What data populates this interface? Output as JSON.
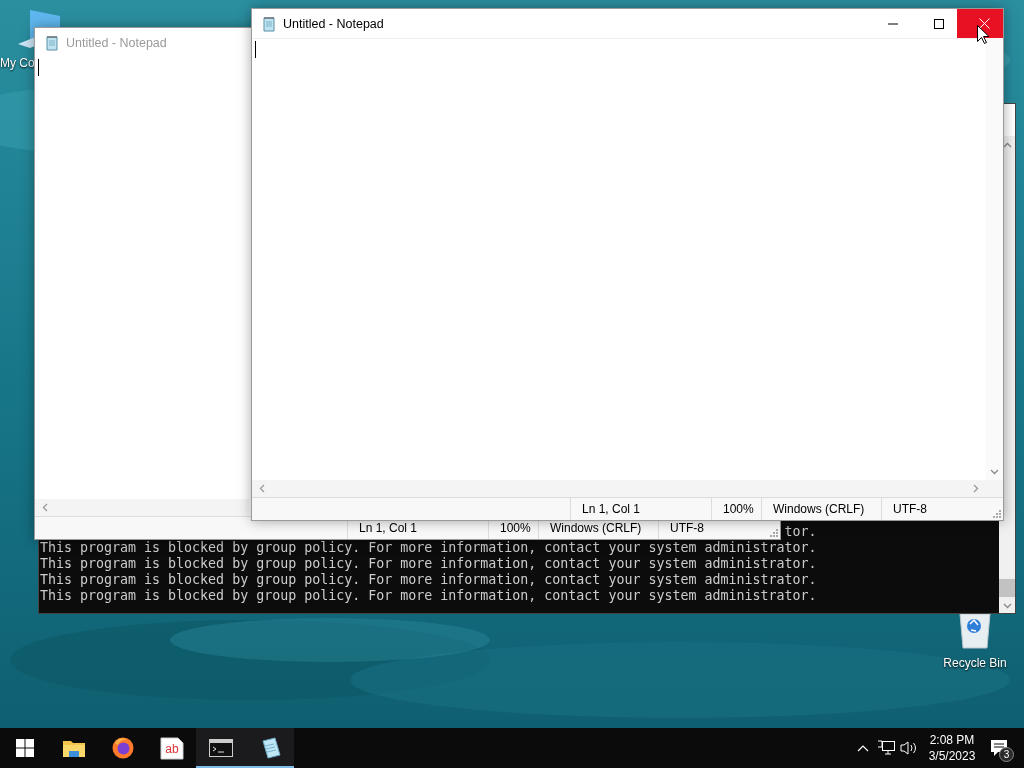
{
  "desktop": {
    "icons": [
      {
        "kind": "computer",
        "label": "My Co"
      },
      {
        "kind": "recycle_bin",
        "label": "Recycle Bin"
      }
    ]
  },
  "console": {
    "lines": [
      "tor.",
      "This program is blocked by group policy. For more information, contact your system administrator.",
      "This program is blocked by group policy. For more information, contact your system administrator.",
      "This program is blocked by group policy. For more information, contact your system administrator.",
      "This program is blocked by group policy. For more information, contact your system administrator."
    ]
  },
  "windows": [
    {
      "title": "Untitled - Notepad",
      "active": false,
      "status_bar": [
        "Ln 1, Col 1",
        "100%",
        "Windows (CRLF)",
        "UTF-8"
      ]
    },
    {
      "title": "Untitled - Notepad",
      "active": true,
      "close_hovered": true,
      "status_bar": [
        "Ln 1, Col 1",
        "100%",
        "Windows (CRLF)",
        "UTF-8"
      ]
    }
  ],
  "taskbar": {
    "apps": [
      {
        "kind": "start",
        "running": false
      },
      {
        "kind": "folder",
        "running": false
      },
      {
        "kind": "browser",
        "running": false
      },
      {
        "kind": "editor",
        "glyph": "ab",
        "running": false
      },
      {
        "kind": "terminal",
        "running": true
      },
      {
        "kind": "notepad",
        "running": true
      }
    ],
    "tray": {
      "time": "2:08 PM",
      "date": "3/5/2023",
      "notification_count": "3"
    }
  }
}
